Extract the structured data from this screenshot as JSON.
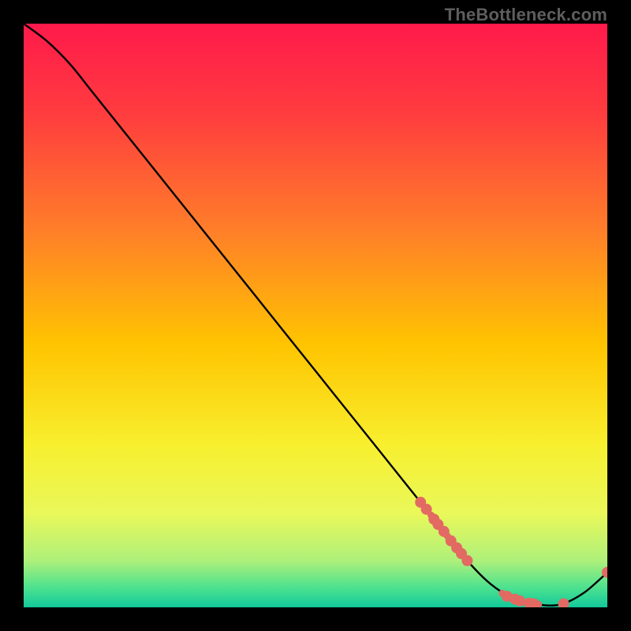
{
  "watermark": "TheBottleneck.com",
  "chart_data": {
    "type": "line",
    "title": "",
    "xlabel": "",
    "ylabel": "",
    "xlim": [
      0,
      100
    ],
    "ylim": [
      0,
      100
    ],
    "grid": false,
    "legend": false,
    "background_gradient": {
      "stops": [
        {
          "offset": 0.0,
          "color": "#ff1a4b"
        },
        {
          "offset": 0.15,
          "color": "#ff3b3f"
        },
        {
          "offset": 0.35,
          "color": "#ff7d2a"
        },
        {
          "offset": 0.55,
          "color": "#ffc400"
        },
        {
          "offset": 0.72,
          "color": "#f8ef2e"
        },
        {
          "offset": 0.84,
          "color": "#e9f85a"
        },
        {
          "offset": 0.92,
          "color": "#aef07a"
        },
        {
          "offset": 0.965,
          "color": "#4fe28f"
        },
        {
          "offset": 1.0,
          "color": "#12c99a"
        }
      ]
    },
    "series": [
      {
        "name": "bottleneck-curve",
        "color": "#000000",
        "x": [
          0,
          4,
          8,
          12,
          20,
          30,
          40,
          50,
          60,
          68,
          72,
          76,
          80,
          84,
          88,
          92,
          96,
          100
        ],
        "y": [
          100,
          97,
          93,
          88,
          78,
          65.5,
          53,
          40.5,
          28,
          18,
          13,
          8,
          4,
          1.5,
          0.5,
          0.5,
          2.5,
          6
        ]
      }
    ],
    "markers": {
      "name": "highlight-points",
      "color": "#e26a63",
      "radius_primary": 7,
      "radius_secondary": 4.5,
      "points": [
        {
          "x": 68.0,
          "y": 18.0,
          "r": "p"
        },
        {
          "x": 69.0,
          "y": 16.8,
          "r": "p"
        },
        {
          "x": 69.8,
          "y": 15.8,
          "r": "s"
        },
        {
          "x": 70.3,
          "y": 15.1,
          "r": "p"
        },
        {
          "x": 71.0,
          "y": 14.2,
          "r": "p"
        },
        {
          "x": 72.0,
          "y": 13.0,
          "r": "p"
        },
        {
          "x": 72.6,
          "y": 12.2,
          "r": "s"
        },
        {
          "x": 73.2,
          "y": 11.4,
          "r": "p"
        },
        {
          "x": 73.8,
          "y": 10.7,
          "r": "s"
        },
        {
          "x": 74.2,
          "y": 10.2,
          "r": "p"
        },
        {
          "x": 75.0,
          "y": 9.2,
          "r": "p"
        },
        {
          "x": 76.0,
          "y": 8.0,
          "r": "p"
        },
        {
          "x": 82.0,
          "y": 2.4,
          "r": "s"
        },
        {
          "x": 82.8,
          "y": 1.9,
          "r": "p"
        },
        {
          "x": 83.6,
          "y": 1.6,
          "r": "s"
        },
        {
          "x": 84.2,
          "y": 1.4,
          "r": "p"
        },
        {
          "x": 85.0,
          "y": 1.1,
          "r": "p"
        },
        {
          "x": 85.8,
          "y": 0.9,
          "r": "s"
        },
        {
          "x": 86.6,
          "y": 0.7,
          "r": "p"
        },
        {
          "x": 87.4,
          "y": 0.6,
          "r": "p"
        },
        {
          "x": 88.2,
          "y": 0.5,
          "r": "s"
        },
        {
          "x": 92.5,
          "y": 0.6,
          "r": "p"
        },
        {
          "x": 100.0,
          "y": 6.0,
          "r": "p"
        }
      ]
    }
  }
}
